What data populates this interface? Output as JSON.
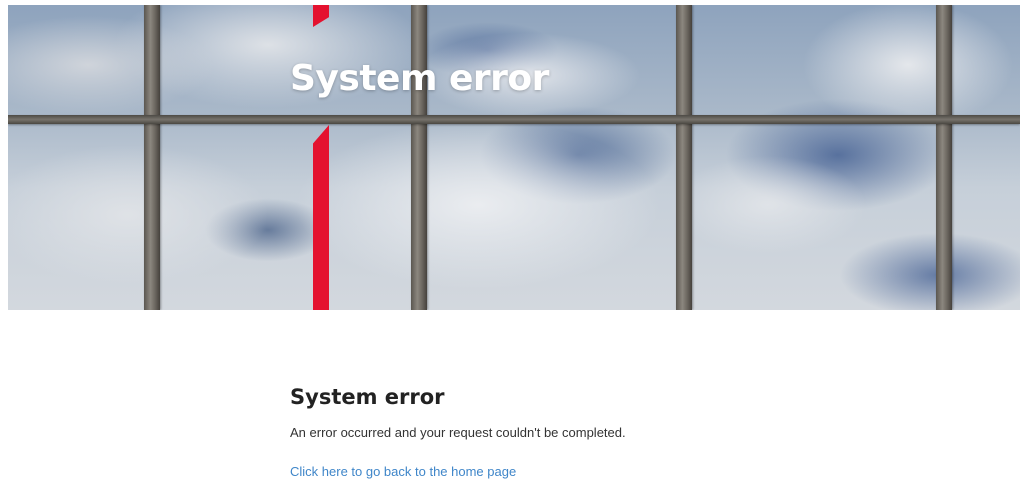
{
  "hero": {
    "title": "System error"
  },
  "main": {
    "heading": "System error",
    "message": "An error occurred and your request couldn't be completed.",
    "home_link_label": "Click here to go back to the home page"
  },
  "colors": {
    "accent": "#e4122f",
    "link": "#3f86c9",
    "heading_text": "#222222",
    "body_text": "#333333"
  }
}
